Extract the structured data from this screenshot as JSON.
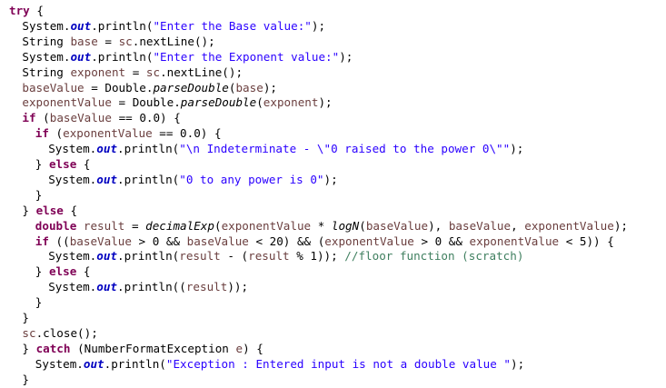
{
  "code": {
    "lines": [
      {
        "indent": 0,
        "tokens": [
          {
            "t": "try",
            "c": "kw"
          },
          {
            "t": " {"
          }
        ]
      },
      {
        "indent": 1,
        "tokens": [
          {
            "t": "System."
          },
          {
            "t": "out",
            "c": "field"
          },
          {
            "t": ".println("
          },
          {
            "t": "\"Enter the Base value:\"",
            "c": "str"
          },
          {
            "t": ");"
          }
        ]
      },
      {
        "indent": 1,
        "tokens": [
          {
            "t": "String "
          },
          {
            "t": "base",
            "c": "var"
          },
          {
            "t": " = "
          },
          {
            "t": "sc",
            "c": "var"
          },
          {
            "t": ".nextLine();"
          }
        ]
      },
      {
        "indent": 1,
        "tokens": [
          {
            "t": "System."
          },
          {
            "t": "out",
            "c": "field"
          },
          {
            "t": ".println("
          },
          {
            "t": "\"Enter the Exponent value:\"",
            "c": "str"
          },
          {
            "t": ");"
          }
        ]
      },
      {
        "indent": 1,
        "tokens": [
          {
            "t": "String "
          },
          {
            "t": "exponent",
            "c": "var"
          },
          {
            "t": " = "
          },
          {
            "t": "sc",
            "c": "var"
          },
          {
            "t": ".nextLine();"
          }
        ]
      },
      {
        "indent": 1,
        "tokens": [
          {
            "t": "baseValue",
            "c": "var"
          },
          {
            "t": " = Double."
          },
          {
            "t": "parseDouble",
            "c": "static"
          },
          {
            "t": "("
          },
          {
            "t": "base",
            "c": "var"
          },
          {
            "t": ");"
          }
        ]
      },
      {
        "indent": 1,
        "tokens": [
          {
            "t": "exponentValue",
            "c": "var"
          },
          {
            "t": " = Double."
          },
          {
            "t": "parseDouble",
            "c": "static"
          },
          {
            "t": "("
          },
          {
            "t": "exponent",
            "c": "var"
          },
          {
            "t": ");"
          }
        ]
      },
      {
        "indent": 1,
        "tokens": [
          {
            "t": "if",
            "c": "kw"
          },
          {
            "t": " ("
          },
          {
            "t": "baseValue",
            "c": "var"
          },
          {
            "t": " == 0.0) {"
          }
        ]
      },
      {
        "indent": 2,
        "tokens": [
          {
            "t": "if",
            "c": "kw"
          },
          {
            "t": " ("
          },
          {
            "t": "exponentValue",
            "c": "var"
          },
          {
            "t": " == 0.0) {"
          }
        ]
      },
      {
        "indent": 3,
        "tokens": [
          {
            "t": "System."
          },
          {
            "t": "out",
            "c": "field"
          },
          {
            "t": ".println("
          },
          {
            "t": "\"\\n Indeterminate - \\\"0 raised to the power 0\\\"\"",
            "c": "str"
          },
          {
            "t": ");"
          }
        ]
      },
      {
        "indent": 2,
        "tokens": [
          {
            "t": "} "
          },
          {
            "t": "else",
            "c": "kw"
          },
          {
            "t": " {"
          }
        ]
      },
      {
        "indent": 3,
        "tokens": [
          {
            "t": "System."
          },
          {
            "t": "out",
            "c": "field"
          },
          {
            "t": ".println("
          },
          {
            "t": "\"0 to any power is 0\"",
            "c": "str"
          },
          {
            "t": ");"
          }
        ]
      },
      {
        "indent": 2,
        "tokens": [
          {
            "t": "}"
          }
        ]
      },
      {
        "indent": 1,
        "tokens": [
          {
            "t": "} "
          },
          {
            "t": "else",
            "c": "kw"
          },
          {
            "t": " {"
          }
        ]
      },
      {
        "indent": 2,
        "tokens": [
          {
            "t": "double",
            "c": "kw"
          },
          {
            "t": " "
          },
          {
            "t": "result",
            "c": "var"
          },
          {
            "t": " = "
          },
          {
            "t": "decimalExp",
            "c": "static"
          },
          {
            "t": "("
          },
          {
            "t": "exponentValue",
            "c": "var"
          },
          {
            "t": " * "
          },
          {
            "t": "logN",
            "c": "static"
          },
          {
            "t": "("
          },
          {
            "t": "baseValue",
            "c": "var"
          },
          {
            "t": "), "
          },
          {
            "t": "baseValue",
            "c": "var"
          },
          {
            "t": ", "
          },
          {
            "t": "exponentValue",
            "c": "var"
          },
          {
            "t": ");"
          }
        ]
      },
      {
        "indent": 2,
        "tokens": [
          {
            "t": "if",
            "c": "kw"
          },
          {
            "t": " (("
          },
          {
            "t": "baseValue",
            "c": "var"
          },
          {
            "t": " > 0 && "
          },
          {
            "t": "baseValue",
            "c": "var"
          },
          {
            "t": " < 20) && ("
          },
          {
            "t": "exponentValue",
            "c": "var"
          },
          {
            "t": " > 0 && "
          },
          {
            "t": "exponentValue",
            "c": "var"
          },
          {
            "t": " < 5)) {"
          }
        ]
      },
      {
        "indent": 3,
        "tokens": [
          {
            "t": "System."
          },
          {
            "t": "out",
            "c": "field"
          },
          {
            "t": ".println("
          },
          {
            "t": "result",
            "c": "var"
          },
          {
            "t": " - ("
          },
          {
            "t": "result",
            "c": "var"
          },
          {
            "t": " % 1)); "
          },
          {
            "t": "//floor function (scratch)",
            "c": "comment"
          }
        ]
      },
      {
        "indent": 2,
        "tokens": [
          {
            "t": "} "
          },
          {
            "t": "else",
            "c": "kw"
          },
          {
            "t": " {"
          }
        ]
      },
      {
        "indent": 3,
        "tokens": [
          {
            "t": "System."
          },
          {
            "t": "out",
            "c": "field"
          },
          {
            "t": ".println(("
          },
          {
            "t": "result",
            "c": "var"
          },
          {
            "t": "));"
          }
        ]
      },
      {
        "indent": 2,
        "tokens": [
          {
            "t": "}"
          }
        ]
      },
      {
        "indent": 1,
        "tokens": [
          {
            "t": "}"
          }
        ]
      },
      {
        "indent": 1,
        "tokens": [
          {
            "t": "sc",
            "c": "var"
          },
          {
            "t": ".close();"
          }
        ]
      },
      {
        "indent": 1,
        "tokens": [
          {
            "t": "} "
          },
          {
            "t": "catch",
            "c": "kw"
          },
          {
            "t": " (NumberFormatException "
          },
          {
            "t": "e",
            "c": "var"
          },
          {
            "t": ") {"
          }
        ]
      },
      {
        "indent": 2,
        "tokens": [
          {
            "t": "System."
          },
          {
            "t": "out",
            "c": "field"
          },
          {
            "t": ".println("
          },
          {
            "t": "\"Exception : Entered input is not a double value \"",
            "c": "str"
          },
          {
            "t": ");"
          }
        ]
      },
      {
        "indent": 1,
        "tokens": [
          {
            "t": "}"
          }
        ]
      }
    ]
  }
}
